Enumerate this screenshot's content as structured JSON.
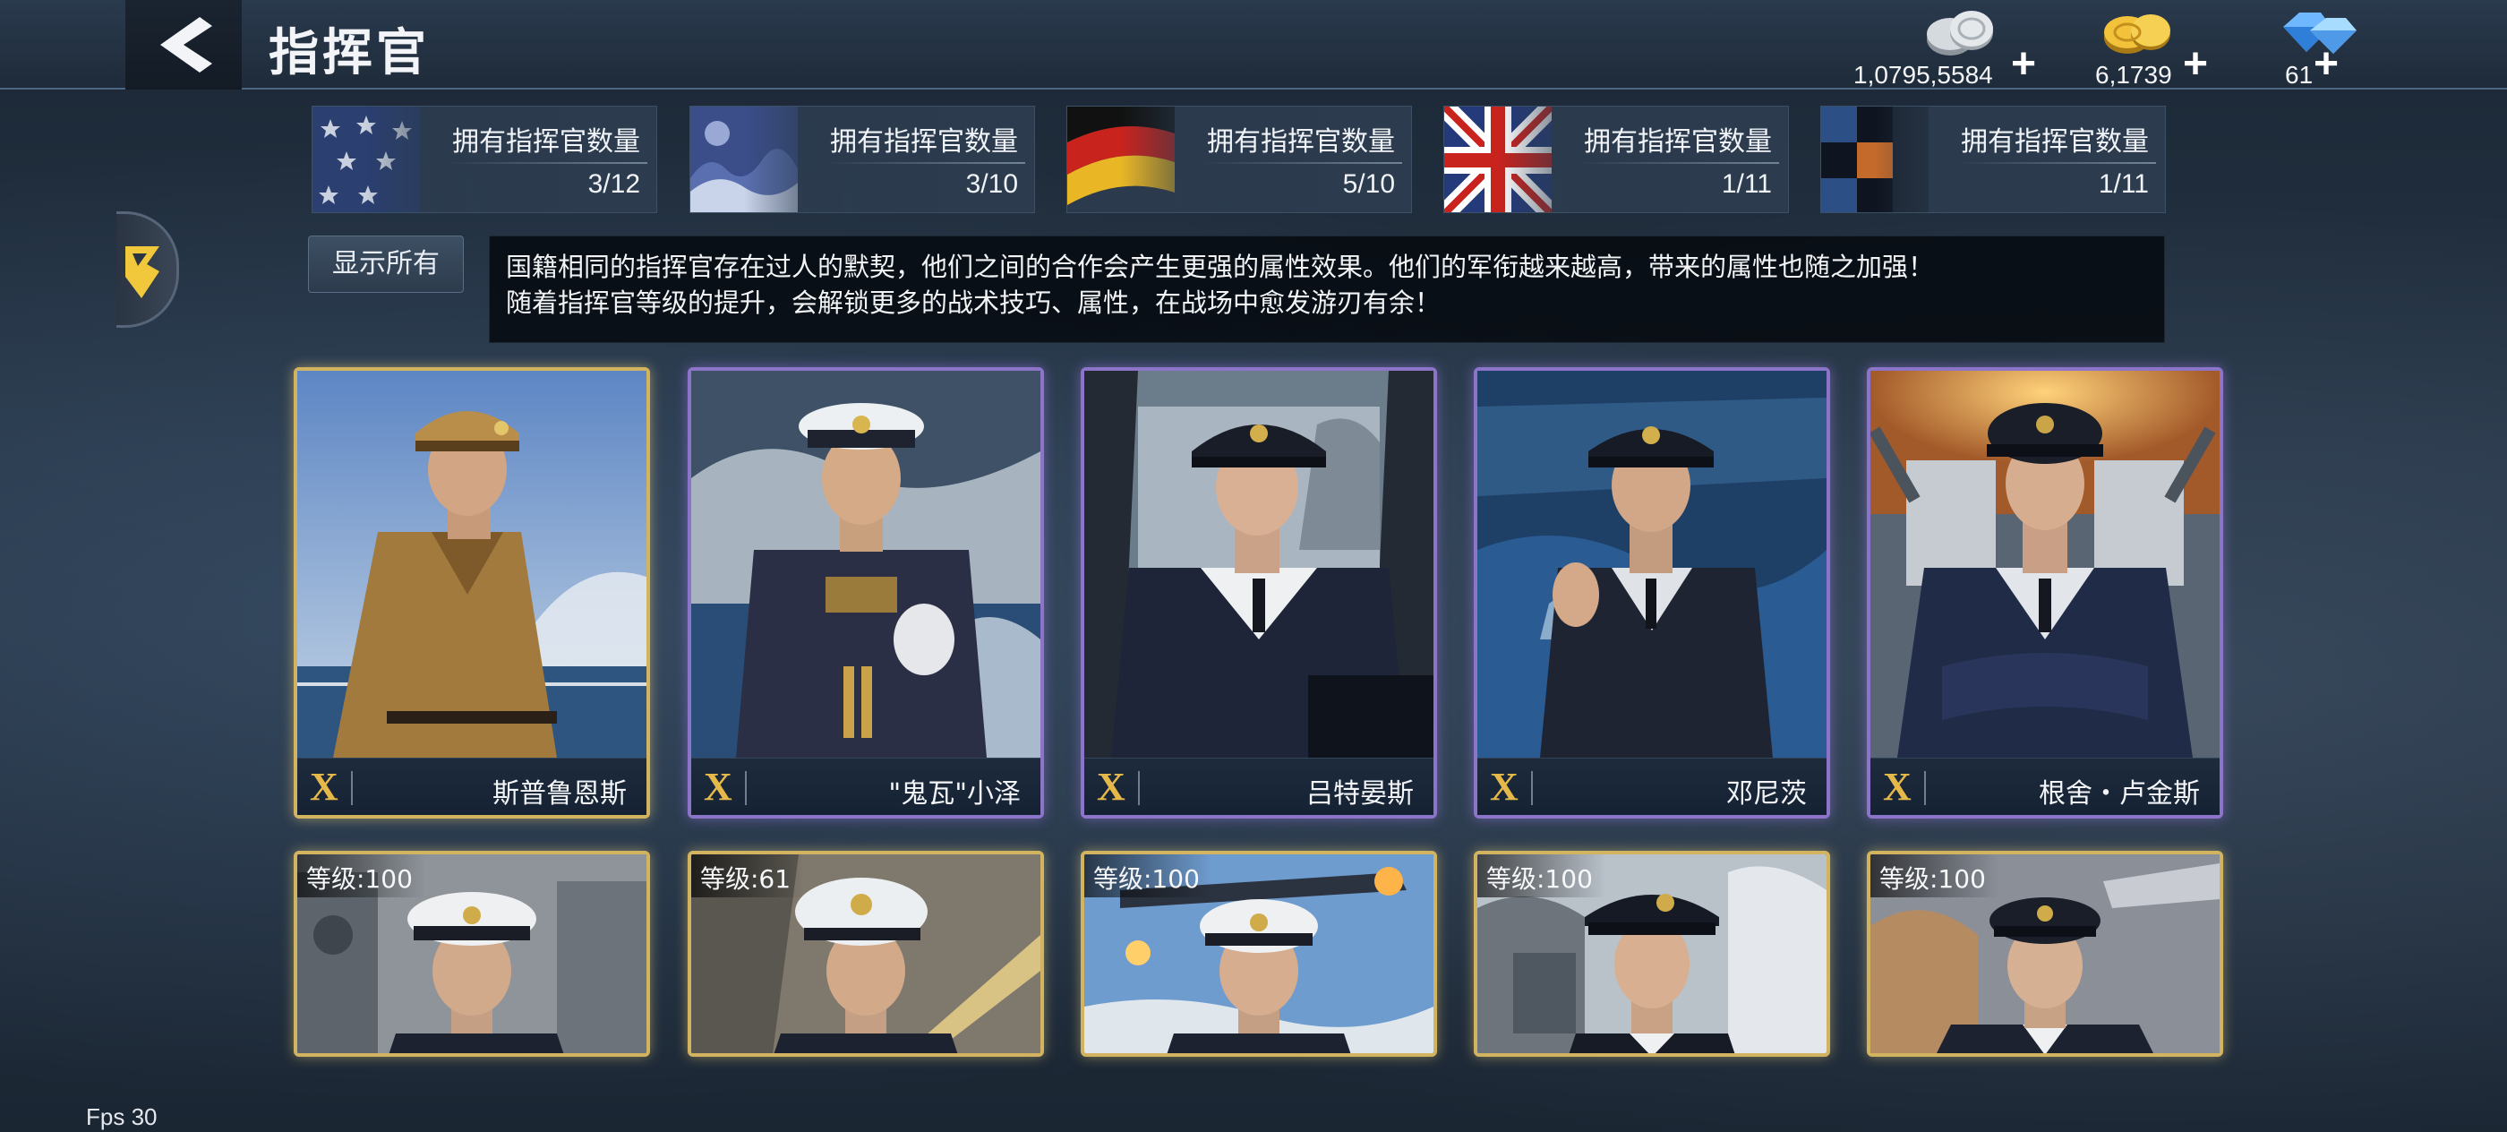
{
  "header": {
    "title": "指挥官",
    "currencies": [
      {
        "icon": "silver-coin-icon",
        "amount": "1,0795,5584",
        "add": "+"
      },
      {
        "icon": "gold-coin-icon",
        "amount": "6,1739",
        "add": "+"
      },
      {
        "icon": "diamond-icon",
        "amount": "61",
        "add": "+"
      }
    ]
  },
  "nations": [
    {
      "flag": "usa-flag",
      "label": "拥有指挥官数量",
      "count": "3/12"
    },
    {
      "flag": "japan-wave-flag",
      "label": "拥有指挥官数量",
      "count": "3/10"
    },
    {
      "flag": "germany-flag",
      "label": "拥有指挥官数量",
      "count": "5/10"
    },
    {
      "flag": "uk-flag",
      "label": "拥有指挥官数量",
      "count": "1/11"
    },
    {
      "flag": "other-nation-flag",
      "label": "拥有指挥官数量",
      "count": "1/11"
    }
  ],
  "filter": {
    "show_all": "显示所有"
  },
  "description": {
    "line1": "国籍相同的指挥官存在过人的默契，他们之间的合作会产生更强的属性效果。他们的军衔越来越高，带来的属性也随之加强！",
    "line2": "随着指挥官等级的提升，会解锁更多的战术技巧、属性，在战场中愈发游刃有余！"
  },
  "commanders": [
    {
      "rank": "X",
      "name": "斯普鲁恩斯",
      "frame": "gold"
    },
    {
      "rank": "X",
      "name": "\"鬼瓦\"小泽",
      "frame": "purple"
    },
    {
      "rank": "X",
      "name": "吕特晏斯",
      "frame": "purple"
    },
    {
      "rank": "X",
      "name": "邓尼茨",
      "frame": "purple"
    },
    {
      "rank": "X",
      "name": "根舍・卢金斯",
      "frame": "purple"
    }
  ],
  "commanders_row2": [
    {
      "level": "等级:100"
    },
    {
      "level": "等级:61"
    },
    {
      "level": "等级:100"
    },
    {
      "level": "等级:100"
    },
    {
      "level": "等级:100"
    }
  ],
  "footer": {
    "fps": "Fps 30"
  },
  "colors": {
    "gold_frame": "#d2b35f",
    "purple_frame": "#8c74c9",
    "rank_x": "#e5b84a"
  }
}
